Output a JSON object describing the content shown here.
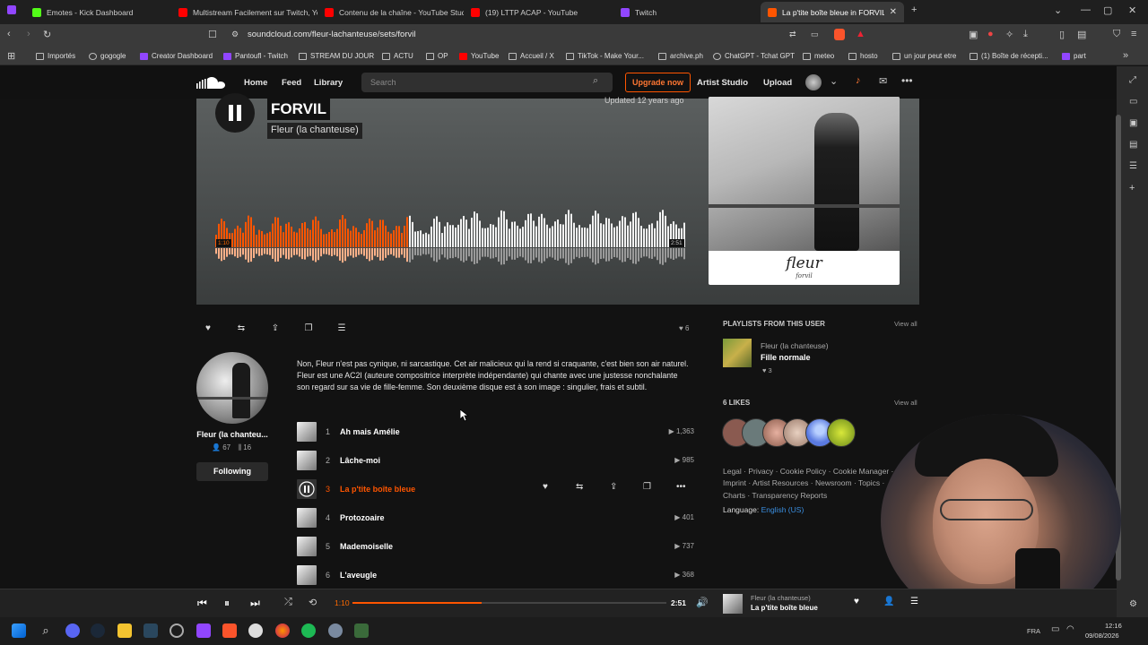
{
  "browser": {
    "tabs": [
      {
        "label": "Emotes - Kick Dashboard",
        "color": "#53fc18"
      },
      {
        "label": "Multistream Facilement sur Twitch, Yo",
        "color": "#ff0000"
      },
      {
        "label": "Contenu de la chaîne - YouTube Studi",
        "color": "#ff0000"
      },
      {
        "label": "(19) LTTP ACAP - YouTube",
        "color": "#ff0000"
      },
      {
        "label": "Twitch",
        "color": "#9146ff"
      },
      {
        "label": "La p'tite boîte bleue in FORVIL",
        "color": "#ff5500"
      }
    ],
    "url": "soundcloud.com/fleur-lachanteuse/sets/forvil",
    "bookmarks": [
      "Importés",
      "gogogle",
      "Creator Dashboard",
      "Pantoufl - Twitch",
      "STREAM DU JOUR",
      "ACTU",
      "OP",
      "YouTube",
      "Accueil / X",
      "TikTok - Make Your...",
      "archive.ph",
      "ChatGPT - Tchat GPT",
      "meteo",
      "hosto",
      "un jour peut etre",
      "(1) Boîte de récepti...",
      "part"
    ]
  },
  "nav": {
    "home": "Home",
    "feed": "Feed",
    "library": "Library",
    "search_placeholder": "Search",
    "upgrade": "Upgrade now",
    "artist_studio": "Artist Studio",
    "upload": "Upload"
  },
  "playlist": {
    "title": "FORVIL",
    "artist": "Fleur (la chanteuse)",
    "updated": "Updated 12 years ago",
    "elapsed": "1:10",
    "duration": "2:51",
    "progress": 0.41,
    "cover_title": "fleur",
    "cover_subtitle": "forvil",
    "likes_count": "6",
    "description": "Non, Fleur n'est pas cynique, ni sarcastique. Cet air malicieux qui la rend si craquante, c'est bien son air naturel. Fleur est une AC2I (auteure compositrice interprète indépendante) qui chante avec une justesse nonchalante son regard sur sa vie de fille-femme. Son deuxième disque est à son image : singulier, frais et subtil."
  },
  "artist": {
    "name": "Fleur (la chanteu...",
    "followers": "67",
    "tracks": "16",
    "follow_label": "Following"
  },
  "tracks": [
    {
      "num": "1",
      "name": "Ah mais Amélie",
      "plays": "1,363"
    },
    {
      "num": "2",
      "name": "Lâche-moi",
      "plays": "985"
    },
    {
      "num": "3",
      "name": "La p'tite boîte bleue",
      "plays": ""
    },
    {
      "num": "4",
      "name": "Protozoaire",
      "plays": "401"
    },
    {
      "num": "5",
      "name": "Mademoiselle",
      "plays": "737"
    },
    {
      "num": "6",
      "name": "L'aveugle",
      "plays": "368"
    }
  ],
  "sidebar": {
    "playlists_heading": "PLAYLISTS FROM THIS USER",
    "view_all": "View all",
    "playlist_artist": "Fleur (la chanteuse)",
    "playlist_name": "Fille normale",
    "playlist_likes": "3",
    "likes_heading": "6 LIKES",
    "footer_line1": "Legal · Privacy · Cookie Policy · Cookie Manager ·",
    "footer_line2": "Imprint · Artist Resources · Newsroom · Topics ·",
    "footer_line3": "Charts · Transparency Reports",
    "language_label": "Language:",
    "language_value": "English (US)"
  },
  "player": {
    "elapsed": "1:10",
    "duration": "2:51",
    "progress": 0.41,
    "artist": "Fleur (la chanteuse)",
    "track": "La p'tite boîte bleue"
  },
  "taskbar": {
    "lang": "FRA",
    "time": "12:16",
    "date": "09/08/2026"
  },
  "colors": {
    "accent": "#ff5500",
    "bg": "#121212"
  }
}
